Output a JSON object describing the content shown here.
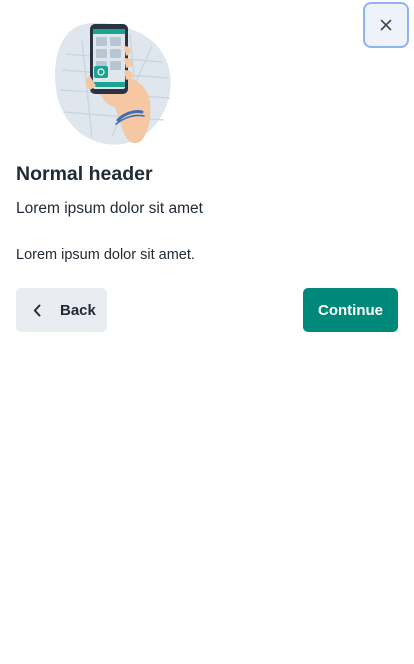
{
  "dialog": {
    "close_icon": "close-icon",
    "illustration": "phone-in-hand-illustration",
    "title": "Normal header",
    "subtitle": "Lorem ipsum dolor sit amet",
    "body": "Lorem ipsum dolor sit amet.",
    "buttons": {
      "back_label": "Back",
      "back_icon": "chevron-left-icon",
      "continue_label": "Continue"
    }
  },
  "colors": {
    "accent": "#00897b",
    "secondary_button": "#e9edf1",
    "text": "#212b36",
    "focus_ring": "#8db4f0"
  }
}
